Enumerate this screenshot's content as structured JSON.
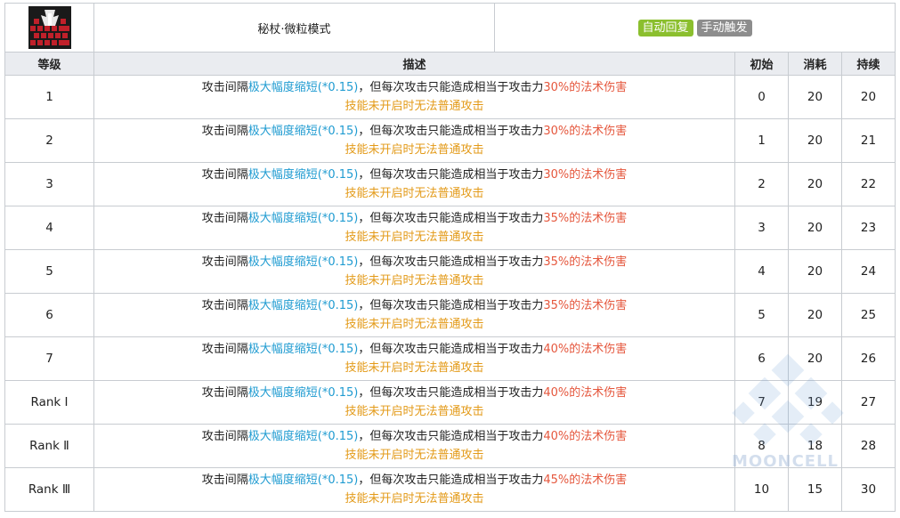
{
  "skill": {
    "name": "秘杖·微粒模式",
    "tags": [
      {
        "label": "自动回复",
        "color": "#8bbf2e"
      },
      {
        "label": "手动触发",
        "color": "#8d8d8d"
      }
    ],
    "icon": "skill-icon-red-black"
  },
  "columns": {
    "level": "等级",
    "description": "描述",
    "initial": "初始",
    "cost": "消耗",
    "duration": "持续"
  },
  "rows": [
    {
      "level": "1",
      "d_a": "攻击间隔",
      "d_b": "极大幅度缩短(*0.15)",
      "d_c": "，但每次攻击只能造成相当于攻击力",
      "d_d": "30%的法术伤害",
      "d_e": "技能未开启时无法普通攻击",
      "initial": "0",
      "cost": "20",
      "duration": "20"
    },
    {
      "level": "2",
      "d_a": "攻击间隔",
      "d_b": "极大幅度缩短(*0.15)",
      "d_c": "，但每次攻击只能造成相当于攻击力",
      "d_d": "30%的法术伤害",
      "d_e": "技能未开启时无法普通攻击",
      "initial": "1",
      "cost": "20",
      "duration": "21"
    },
    {
      "level": "3",
      "d_a": "攻击间隔",
      "d_b": "极大幅度缩短(*0.15)",
      "d_c": "，但每次攻击只能造成相当于攻击力",
      "d_d": "30%的法术伤害",
      "d_e": "技能未开启时无法普通攻击",
      "initial": "2",
      "cost": "20",
      "duration": "22"
    },
    {
      "level": "4",
      "d_a": "攻击间隔",
      "d_b": "极大幅度缩短(*0.15)",
      "d_c": "，但每次攻击只能造成相当于攻击力",
      "d_d": "35%的法术伤害",
      "d_e": "技能未开启时无法普通攻击",
      "initial": "3",
      "cost": "20",
      "duration": "23"
    },
    {
      "level": "5",
      "d_a": "攻击间隔",
      "d_b": "极大幅度缩短(*0.15)",
      "d_c": "，但每次攻击只能造成相当于攻击力",
      "d_d": "35%的法术伤害",
      "d_e": "技能未开启时无法普通攻击",
      "initial": "4",
      "cost": "20",
      "duration": "24"
    },
    {
      "level": "6",
      "d_a": "攻击间隔",
      "d_b": "极大幅度缩短(*0.15)",
      "d_c": "，但每次攻击只能造成相当于攻击力",
      "d_d": "35%的法术伤害",
      "d_e": "技能未开启时无法普通攻击",
      "initial": "5",
      "cost": "20",
      "duration": "25"
    },
    {
      "level": "7",
      "d_a": "攻击间隔",
      "d_b": "极大幅度缩短(*0.15)",
      "d_c": "，但每次攻击只能造成相当于攻击力",
      "d_d": "40%的法术伤害",
      "d_e": "技能未开启时无法普通攻击",
      "initial": "6",
      "cost": "20",
      "duration": "26"
    },
    {
      "level": "Rank Ⅰ",
      "d_a": "攻击间隔",
      "d_b": "极大幅度缩短(*0.15)",
      "d_c": "，但每次攻击只能造成相当于攻击力",
      "d_d": "40%的法术伤害",
      "d_e": "技能未开启时无法普通攻击",
      "initial": "7",
      "cost": "19",
      "duration": "27"
    },
    {
      "level": "Rank Ⅱ",
      "d_a": "攻击间隔",
      "d_b": "极大幅度缩短(*0.15)",
      "d_c": "，但每次攻击只能造成相当于攻击力",
      "d_d": "40%的法术伤害",
      "d_e": "技能未开启时无法普通攻击",
      "initial": "8",
      "cost": "18",
      "duration": "28"
    },
    {
      "level": "Rank Ⅲ",
      "d_a": "攻击间隔",
      "d_b": "极大幅度缩短(*0.15)",
      "d_c": "，但每次攻击只能造成相当于攻击力",
      "d_d": "45%的法术伤害",
      "d_e": "技能未开启时无法普通攻击",
      "initial": "10",
      "cost": "15",
      "duration": "30"
    }
  ],
  "colors": {
    "highlight_blue": "#1f9bd1",
    "highlight_red": "#e5573d",
    "highlight_orange": "#e39a18",
    "header_bg": "#eaecf0",
    "border": "#c8ccd1"
  },
  "watermark": {
    "text": "MOONCELL",
    "icon": "mooncell-diamond-logo"
  }
}
